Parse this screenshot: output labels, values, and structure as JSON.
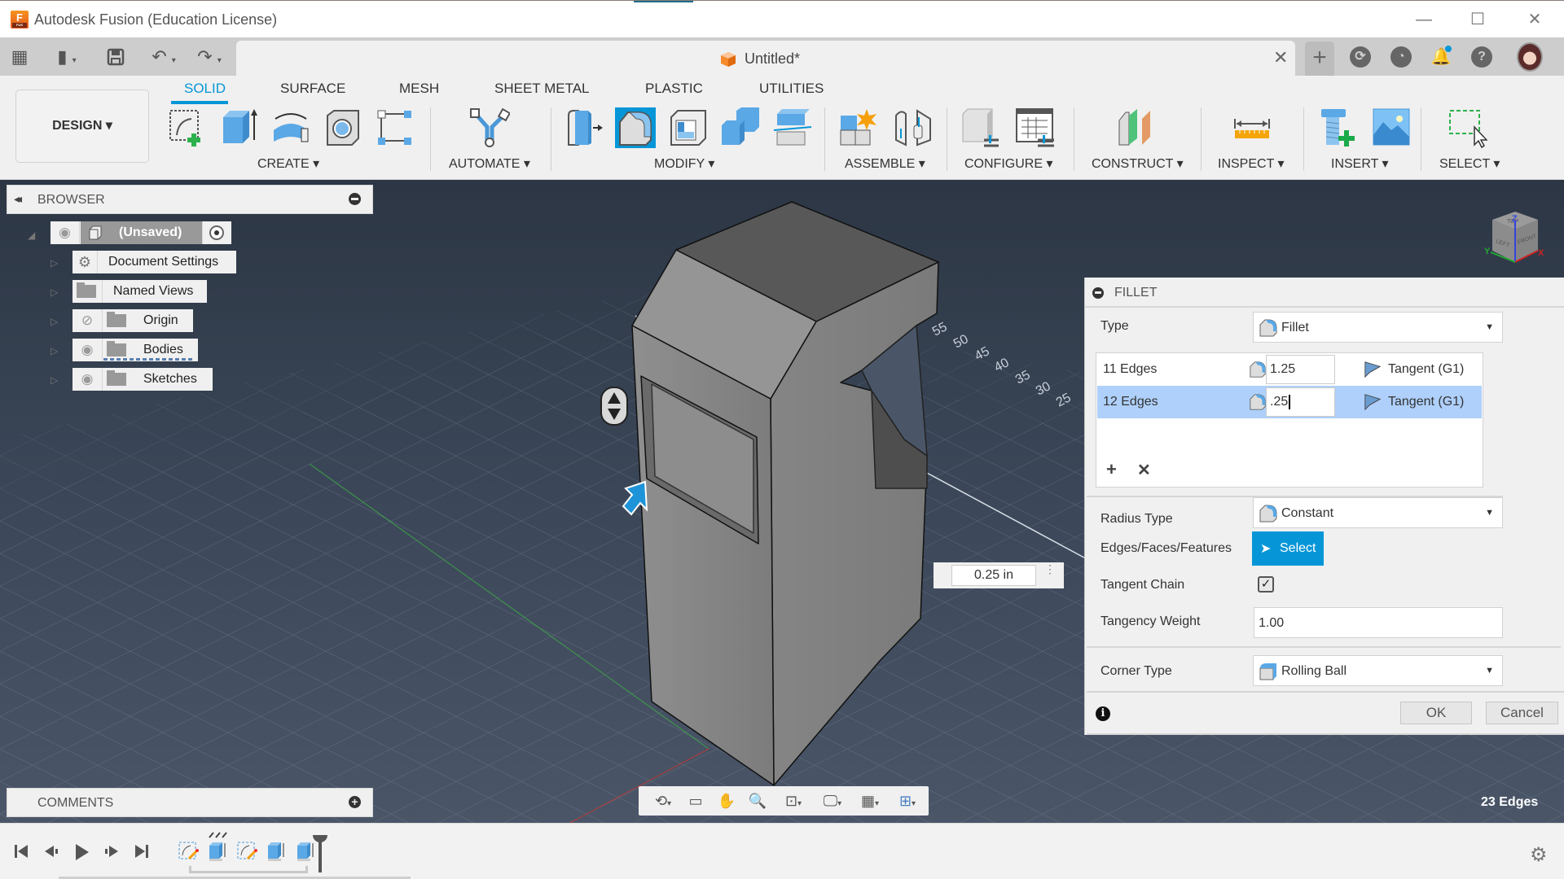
{
  "window": {
    "title": "Autodesk Fusion (Education License)",
    "app_icon_letter": "F",
    "app_icon_sub": "FUS",
    "controls": {
      "minimize": "—",
      "maximize": "☐",
      "close": "✕"
    }
  },
  "quick_access": {
    "grid_icon": "▦",
    "file_icon": "▮",
    "save_icon": "💾",
    "undo_icon": "↶",
    "redo_icon": "↷",
    "caret": "▾"
  },
  "document": {
    "title": "Untitled*",
    "close": "✕",
    "new_tab": "+"
  },
  "header_right": {
    "extensions_icon": "⟳",
    "job_status_icon": "◔",
    "notifications_icon": "🔔",
    "help_icon": "?"
  },
  "workspace": {
    "label": "DESIGN ▾"
  },
  "ribbon": {
    "tabs": [
      {
        "label": "SOLID",
        "active": true
      },
      {
        "label": "SURFACE",
        "active": false
      },
      {
        "label": "MESH",
        "active": false
      },
      {
        "label": "SHEET METAL",
        "active": false
      },
      {
        "label": "PLASTIC",
        "active": false
      },
      {
        "label": "UTILITIES",
        "active": false
      }
    ],
    "groups": [
      {
        "label": "CREATE ▾"
      },
      {
        "label": "AUTOMATE ▾"
      },
      {
        "label": "MODIFY ▾"
      },
      {
        "label": "ASSEMBLE ▾"
      },
      {
        "label": "CONFIGURE ▾"
      },
      {
        "label": "CONSTRUCT ▾"
      },
      {
        "label": "INSPECT ▾"
      },
      {
        "label": "INSERT ▾"
      },
      {
        "label": "SELECT ▾"
      }
    ]
  },
  "browser": {
    "title": "BROWSER",
    "collapse_icon": "◂◂",
    "root": {
      "label": "(Unsaved)"
    },
    "items": [
      {
        "label": "Document Settings",
        "icon": "gear"
      },
      {
        "label": "Named Views",
        "icon": "folder"
      },
      {
        "label": "Origin",
        "icon": "folder",
        "visibility": "hidden"
      },
      {
        "label": "Bodies",
        "icon": "folder",
        "visibility": "visible"
      },
      {
        "label": "Sketches",
        "icon": "folder",
        "visibility": "visible"
      }
    ],
    "eye_visible": "◉",
    "eye_hidden": "⊘",
    "expand_arrow": "▷",
    "root_arrow": "◢"
  },
  "comments": {
    "title": "COMMENTS",
    "add_icon": "+"
  },
  "viewport": {
    "grid_labels": [
      "55",
      "50",
      "45",
      "40",
      "35",
      "30",
      "25"
    ],
    "distance_value": "0.25 in",
    "distance_more": "⋮",
    "selection_status": "23 Edges",
    "viewcube": {
      "top": "TOP",
      "left": "LEFT",
      "front": "FRONT",
      "x": "X",
      "y": "Y",
      "z": "Z"
    }
  },
  "fillet": {
    "title": "FILLET",
    "type_label": "Type",
    "type_value": "Fillet",
    "edge_sets": [
      {
        "count": "11 Edges",
        "radius": "1.25",
        "continuity": "Tangent (G1)",
        "selected": false
      },
      {
        "count": "12 Edges",
        "radius": ".25",
        "continuity": "Tangent (G1)",
        "selected": true
      }
    ],
    "add_icon": "+",
    "remove_icon": "✕",
    "radius_type_label": "Radius Type",
    "radius_type_value": "Constant",
    "selection_label": "Edges/Faces/Features",
    "select_button": "Select",
    "select_arrow": "➤",
    "tangent_chain_label": "Tangent Chain",
    "tangent_chain_checked": "✓",
    "tangency_weight_label": "Tangency Weight",
    "tangency_weight_value": "1.00",
    "corner_type_label": "Corner Type",
    "corner_type_value": "Rolling Ball",
    "info_icon": "i",
    "ok": "OK",
    "cancel": "Cancel",
    "dropdown_arrow": "▼"
  },
  "navbar": {
    "orbit": "⟲",
    "look_at": "▭",
    "pan": "✋",
    "zoom": "🔍",
    "fit": "⊡",
    "display": "🖵",
    "grid": "▦",
    "viewports": "⊞",
    "caret": "▾"
  },
  "timeline": {
    "first": "⏮",
    "prev": "◀",
    "play": "▶",
    "next": "▶",
    "last": "⏭",
    "settings": "⚙"
  }
}
